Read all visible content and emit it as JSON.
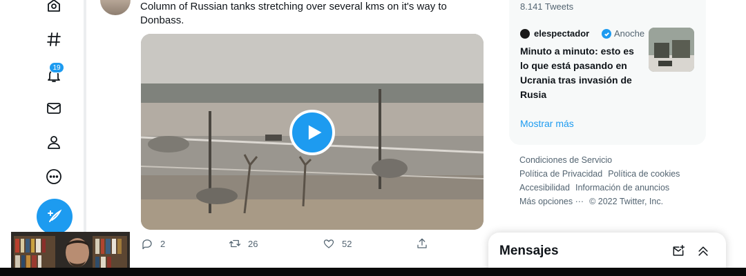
{
  "nav": {
    "notifications_count": "19"
  },
  "tweet": {
    "text": "Column of Russian tanks stretching over several kms on it's way to Donbass.",
    "replies": "2",
    "retweets": "26",
    "likes": "52"
  },
  "sidebar": {
    "tweet_count": "8.141 Tweets",
    "news": {
      "source": "elespectador",
      "time": "Anoche",
      "headline": "Minuto a minuto: esto es lo que está pasando en Ucrania tras invasión de Rusia"
    },
    "show_more": "Mostrar más"
  },
  "footer": {
    "terms": "Condiciones de Servicio",
    "privacy": "Política de Privacidad",
    "cookies": "Política de cookies",
    "accessibility": "Accesibilidad",
    "ads_info": "Información de anuncios",
    "more": "Más opciones ···",
    "copyright": "© 2022 Twitter, Inc."
  },
  "messages": {
    "title": "Mensajes"
  },
  "colors": {
    "accent": "#1d9bf0",
    "text": "#0f1419",
    "muted": "#536471"
  },
  "icons": [
    "explore-icon",
    "hashtag-icon",
    "bell-icon",
    "mail-icon",
    "profile-icon",
    "more-icon",
    "compose-icon",
    "reply-icon",
    "retweet-icon",
    "like-icon",
    "share-icon",
    "play-icon",
    "verified-icon",
    "new-message-icon",
    "collapse-icon"
  ]
}
